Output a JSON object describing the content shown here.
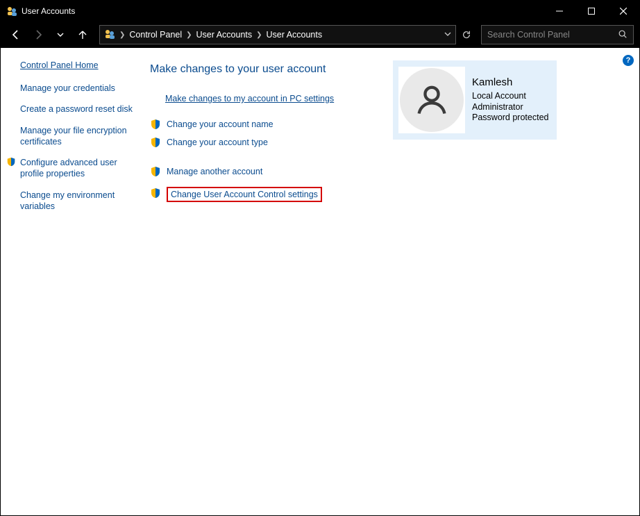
{
  "window": {
    "title": "User Accounts"
  },
  "breadcrumb": {
    "root": "Control Panel",
    "level1": "User Accounts",
    "level2": "User Accounts"
  },
  "search": {
    "placeholder": "Search Control Panel"
  },
  "help": {
    "label": "?"
  },
  "sidebar": {
    "home": "Control Panel Home",
    "links": {
      "manage_credentials": "Manage your credentials",
      "password_reset_disk": "Create a password reset disk",
      "file_encryption_certs": "Manage your file encryption certificates",
      "advanced_profile": "Configure advanced user profile properties",
      "env_vars": "Change my environment variables"
    }
  },
  "main": {
    "heading": "Make changes to your user account",
    "pc_settings_link": "Make changes to my account in PC settings",
    "change_name": "Change your account name",
    "change_type": "Change your account type",
    "manage_another": "Manage another account",
    "uac_settings": "Change User Account Control settings"
  },
  "user": {
    "name": "Kamlesh",
    "type": "Local Account",
    "role": "Administrator",
    "pw": "Password protected"
  }
}
